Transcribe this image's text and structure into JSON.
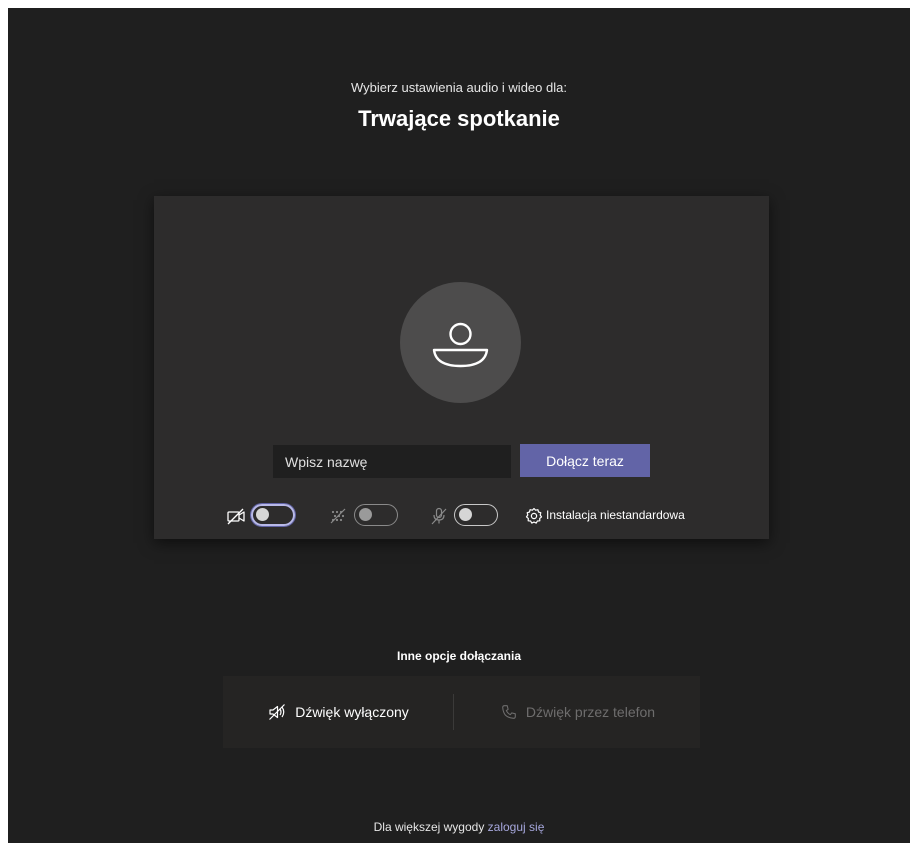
{
  "header": {
    "subtitle": "Wybierz ustawienia audio i wideo dla:",
    "title": "Trwające spotkanie"
  },
  "preview": {
    "avatar_icon": "person-icon",
    "name_input": {
      "placeholder": "Wpisz nazwę",
      "value": ""
    },
    "join_button_label": "Dołącz teraz",
    "controls": {
      "camera": {
        "icon": "camera-off-icon",
        "state": "off"
      },
      "background_blur": {
        "icon": "background-blur-icon",
        "state": "off"
      },
      "microphone": {
        "icon": "mic-off-icon",
        "state": "off"
      },
      "settings": {
        "icon": "gear-icon",
        "label": "Instalacja niestandardowa"
      }
    }
  },
  "other_options": {
    "title": "Inne opcje dołączania",
    "audio_off": {
      "icon": "speaker-off-icon",
      "label": "Dźwięk wyłączony"
    },
    "phone_audio": {
      "icon": "phone-icon",
      "label": "Dźwięk przez telefon",
      "disabled": true
    }
  },
  "footer": {
    "text": "Dla większej wygody ",
    "link": "zaloguj się"
  },
  "colors": {
    "background": "#1f1f1f",
    "panel": "#2d2c2c",
    "accent": "#6264a7",
    "link": "#a6a7dc"
  }
}
